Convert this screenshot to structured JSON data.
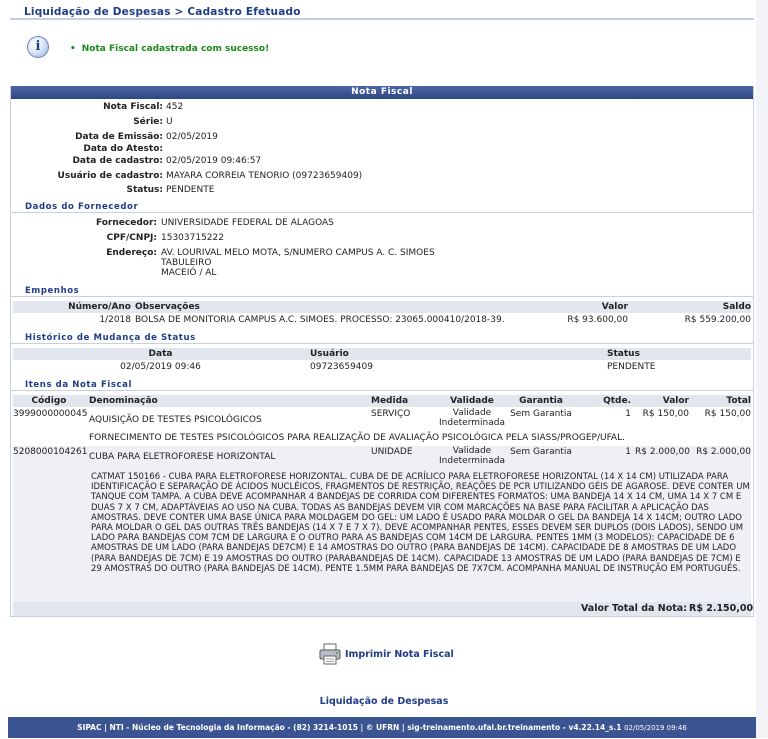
{
  "breadcrumb": "Liquidação de Despesas > Cadastro Efetuado",
  "success_message": "Nota Fiscal cadastrada com sucesso!",
  "panel_title": "Nota Fiscal",
  "nota": {
    "numero_label": "Nota Fiscal:",
    "numero": "452",
    "serie_label": "Série:",
    "serie": "U",
    "emissao_label": "Data de Emissão:",
    "emissao": "02/05/2019",
    "atesto_label": "Data do Atesto:",
    "atesto": "",
    "cadastro_label": "Data de cadastro:",
    "cadastro": "02/05/2019 09:46:57",
    "usuario_label": "Usuário de cadastro:",
    "usuario": "MAYARA CORREIA TENORIO (09723659409)",
    "status_label": "Status:",
    "status": "PENDENTE"
  },
  "fornecedor": {
    "section": "Dados do Fornecedor",
    "nome_label": "Fornecedor:",
    "nome": "UNIVERSIDADE FEDERAL DE ALAGOAS",
    "cpf_label": "CPF/CNPJ:",
    "cpf": "15303715222",
    "endereco_label": "Endereço:",
    "endereco_1": "AV. LOURIVAL MELO MOTA, S/NUMERO CAMPUS A. C. SIMOES",
    "endereco_2": "TABULEIRO",
    "endereco_3": "MACEIÓ / AL"
  },
  "empenhos": {
    "section": "Empenhos",
    "headers": {
      "numero": "Número/Ano",
      "obs": "Observações",
      "valor": "Valor",
      "saldo": "Saldo"
    },
    "rows": [
      {
        "numero": "1/2018",
        "obs": "BOLSA DE MONITORIA CAMPUS A.C. SIMOES. PROCESSO: 23065.000410/2018-39.",
        "valor": "R$ 93.600,00",
        "saldo": "R$ 559.200,00"
      }
    ]
  },
  "historico": {
    "section": "Histórico de Mudança de Status",
    "headers": {
      "data": "Data",
      "usuario": "Usuário",
      "status": "Status"
    },
    "rows": [
      {
        "data": "02/05/2019 09:46",
        "usuario": "09723659409",
        "status": "PENDENTE"
      }
    ]
  },
  "itens": {
    "section": "Itens da Nota Fiscal",
    "headers": {
      "codigo": "Código",
      "denominacao": "Denominação",
      "medida": "Medida",
      "validade": "Validade",
      "garantia": "Garantia",
      "qtde": "Qtde.",
      "valor": "Valor",
      "total": "Total"
    },
    "rows": [
      {
        "codigo": "3999000000045",
        "denominacao": "AQUISIÇÃO DE TESTES PSICOLÓGICOS",
        "medida": "SERVIÇO",
        "validade_1": "Validade",
        "validade_2": "Indeterminada",
        "garantia": "Sem Garantia",
        "qtde": "1",
        "valor": "R$ 150,00",
        "total": "R$ 150,00",
        "descricao": "FORNECIMENTO DE TESTES PSICOLÓGICOS PARA REALIZAÇÃO DE AVALIAÇÃO PSICOLÓGICA PELA SIASS/PROGEP/UFAL."
      },
      {
        "codigo": "5208000104261",
        "denominacao": "CUBA PARA ELETROFORESE HORIZONTAL",
        "medida": "UNIDADE",
        "validade_1": "Validade",
        "validade_2": "Indeterminada",
        "garantia": "Sem Garantia",
        "qtde": "1",
        "valor": "R$ 2.000,00",
        "total": "R$ 2.000,00",
        "descricao": "CATMAT 150166 - CUBA PARA ELETROFORESE HORIZONTAL. CUBA DE DE ACRÍLICO PARA ELETROFORESE HORIZONTAL (14 X 14 CM) UTILIZADA PARA IDENTIFICAÇÃO E SEPARAÇÃO DE ÁCIDOS NUCLÉICOS, FRAGMENTOS DE RESTRIÇÃO, REAÇÕES DE PCR UTILIZANDO GÉIS DE AGAROSE. DEVE CONTER UM TANQUE COM TAMPA. A CUBA DEVE ACOMPANHAR 4 BANDEJAS DE CORRIDA COM DIFERENTES FORMATOS: UMA BANDEJA 14 X 14 CM, UMA 14 X 7 CM E DUAS 7 X 7 CM, ADAPTÁVEIAS AO USO NA CUBA. TODAS AS BANDEJAS DEVEM VIR COM MARCAÇÕES NA BASE PARA FACILITAR A APLICAÇÃO DAS AMOSTRAS. DEVE CONTER UMA BASE ÚNICA PARA MOLDAGEM DO GEL: UM LADO É USADO PARA MOLDAR O GEL DA BANDEJA 14 X 14CM; OUTRO LADO PARA MOLDAR O GEL DAS OUTRAS TRÊS BANDEJAS (14 X 7 E 7 X 7). DEVE ACOMPANHAR PENTES, ESSES DEVEM SER DUPLOS (DOIS LADOS), SENDO UM LADO PARA BANDEJAS COM 7CM DE LARGURA E O OUTRO PARA AS BANDEJAS COM 14CM DE LARGURA. PENTES 1MM (3 MODELOS): CAPACIDADE DE 6 AMOSTRAS DE UM LADO (PARA BANDEJAS DE7CM) E 14 AMOSTRAS DO OUTRO (PARA BANDEJAS DE 14CM). CAPACIDADE DE 8 AMOSTRAS DE UM LADO (PARA BANDEJAS DE 7CM) E 19 AMOSTRAS DO OUTRO (PARABANDEJAS DE 14CM). CAPACIDADE 13 AMOSTRAS DE UM LADO (PARA BANDEJAS DE 7CM) E 29 AMOSTRAS DO OUTRO (PARA BANDEJAS DE 14CM). PENTE 1.5MM PARA BANDEJAS DE 7X7CM. ACOMPANHA MANUAL DE INSTRUÇÃO EM PORTUGUÊS."
      }
    ],
    "total_label": "Valor Total da Nota:",
    "total_value": "R$ 2.150,00"
  },
  "actions": {
    "print_label": "Imprimir Nota Fiscal",
    "back_label": "Liquidação de Despesas"
  },
  "footer": {
    "text": "SIPAC | NTI - Núcleo de Tecnologia da Informação - (82) 3214-1015 | © UFRN | sig-treinamento.ufal.br.treinamento - v4.22.14_s.1",
    "timestamp": "02/05/2019 09:46"
  }
}
